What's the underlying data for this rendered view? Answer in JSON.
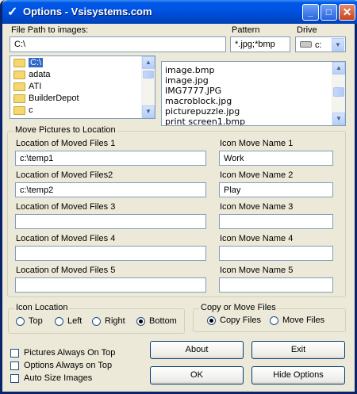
{
  "window": {
    "title": "Options - Vsisystems.com"
  },
  "file_path": {
    "label": "File Path to images:",
    "value": "C:\\"
  },
  "pattern": {
    "label": "Pattern",
    "value": "*.jpg;*bmp"
  },
  "drive": {
    "label": "Drive",
    "value": "c:"
  },
  "folders": [
    "C:\\",
    "adata",
    "ATI",
    "BuilderDepot",
    "c"
  ],
  "files": [
    "image.bmp",
    "image.jpg",
    "IMG7777.JPG",
    "macroblock.jpg",
    "picturepuzzle.jpg",
    "print screen1.bmp"
  ],
  "move_group": {
    "legend": "Move Pictures to Location",
    "rows": [
      {
        "loc_label": "Location of Moved Files 1",
        "loc_value": "c:\\temp1",
        "name_label": "Icon Move Name 1",
        "name_value": "Work"
      },
      {
        "loc_label": "Location of Moved Files2",
        "loc_value": "c:\\temp2",
        "name_label": "Icon Move Name 2",
        "name_value": "Play"
      },
      {
        "loc_label": "Location of Moved Files 3",
        "loc_value": "",
        "name_label": "Icon Move Name 3",
        "name_value": ""
      },
      {
        "loc_label": "Location of Moved Files 4",
        "loc_value": "",
        "name_label": "Icon Move Name 4",
        "name_value": ""
      },
      {
        "loc_label": "Location of Moved Files 5",
        "loc_value": "",
        "name_label": "Icon Move Name 5",
        "name_value": ""
      }
    ]
  },
  "icon_location": {
    "legend": "Icon Location",
    "options": [
      "Top",
      "Left",
      "Right",
      "Bottom"
    ],
    "selected": "Bottom"
  },
  "copy_move": {
    "legend": "Copy or Move Files",
    "options": [
      "Copy Files",
      "Move Files"
    ],
    "selected": "Copy Files"
  },
  "checkboxes": [
    "Pictures Always On Top",
    "Options Always on Top",
    "Auto Size Images"
  ],
  "buttons": {
    "about": "About",
    "exit": "Exit",
    "ok": "OK",
    "hide_options": "Hide Options"
  }
}
